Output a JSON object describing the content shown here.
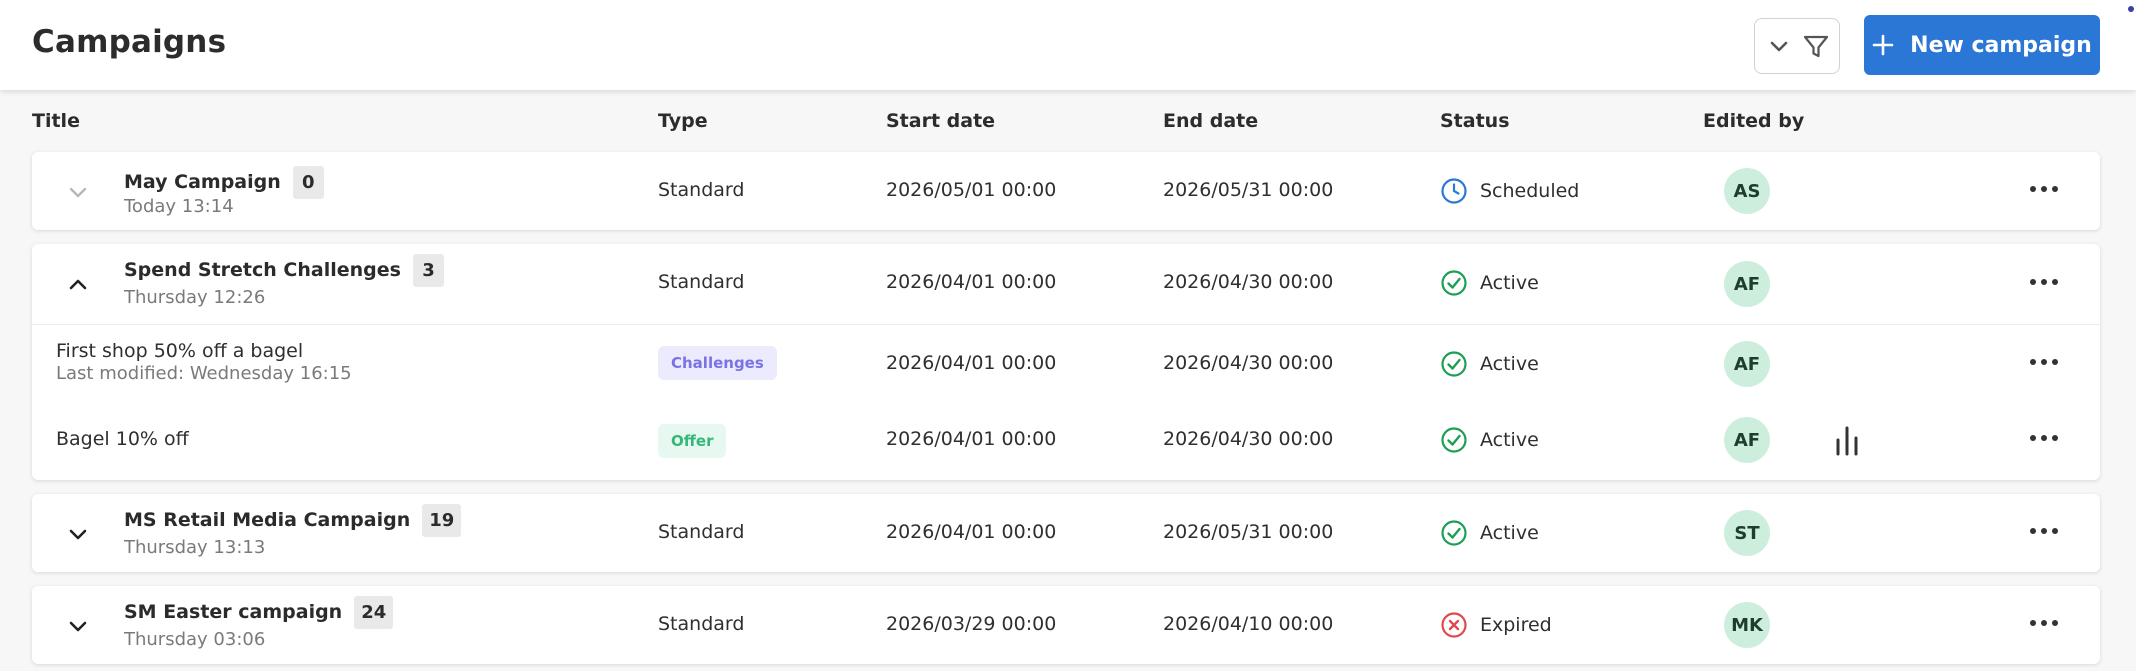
{
  "header": {
    "title": "Campaigns",
    "new_button_label": "New campaign"
  },
  "icons": {
    "filter": "filter-funnel-icon",
    "filter_toggle": "chevron-down-icon",
    "add": "plus-icon",
    "scheduled": "clock-icon",
    "active": "check-circle-icon",
    "expired": "x-circle-icon",
    "more": "more-horizontal-icon",
    "stats": "bar-chart-icon"
  },
  "colors": {
    "accent": "#2a77d6",
    "active": "#1e9e53",
    "expired": "#e2484d",
    "scheduled": "#2a77d6",
    "avatar_bg": "#cdeedd"
  },
  "columns": {
    "title": "Title",
    "type": "Type",
    "start_date": "Start date",
    "end_date": "End date",
    "status": "Status",
    "edited_by": "Edited by"
  },
  "campaigns": [
    {
      "title": "May Campaign",
      "count": "0",
      "modified": "Today 13:14",
      "type": "Standard",
      "start": "2026/05/01 00:00",
      "end": "2026/05/31 00:00",
      "status": "Scheduled",
      "editor": "AS",
      "expanded": false
    },
    {
      "title": "Spend Stretch Challenges",
      "count": "3",
      "modified": "Thursday 12:26",
      "type": "Standard",
      "start": "2026/04/01 00:00",
      "end": "2026/04/30 00:00",
      "status": "Active",
      "editor": "AF",
      "expanded": true,
      "children": [
        {
          "title": "First shop 50% off a bagel",
          "modified": "Last modified: Wednesday 16:15",
          "type": "Challenges",
          "start": "2026/04/01 00:00",
          "end": "2026/04/30 00:00",
          "status": "Active",
          "editor": "AF"
        },
        {
          "title": "Bagel 10% off",
          "type": "Offer",
          "start": "2026/04/01 00:00",
          "end": "2026/04/30 00:00",
          "status": "Active",
          "editor": "AF"
        }
      ]
    },
    {
      "title": "MS Retail Media Campaign",
      "count": "19",
      "modified": "Thursday 13:13",
      "type": "Standard",
      "start": "2026/04/01 00:00",
      "end": "2026/05/31 00:00",
      "status": "Active",
      "editor": "ST",
      "expanded": false
    },
    {
      "title": "SM Easter campaign",
      "count": "24",
      "modified": "Thursday 03:06",
      "type": "Standard",
      "start": "2026/03/29 00:00",
      "end": "2026/04/10 00:00",
      "status": "Expired",
      "editor": "MK",
      "expanded": false
    }
  ]
}
